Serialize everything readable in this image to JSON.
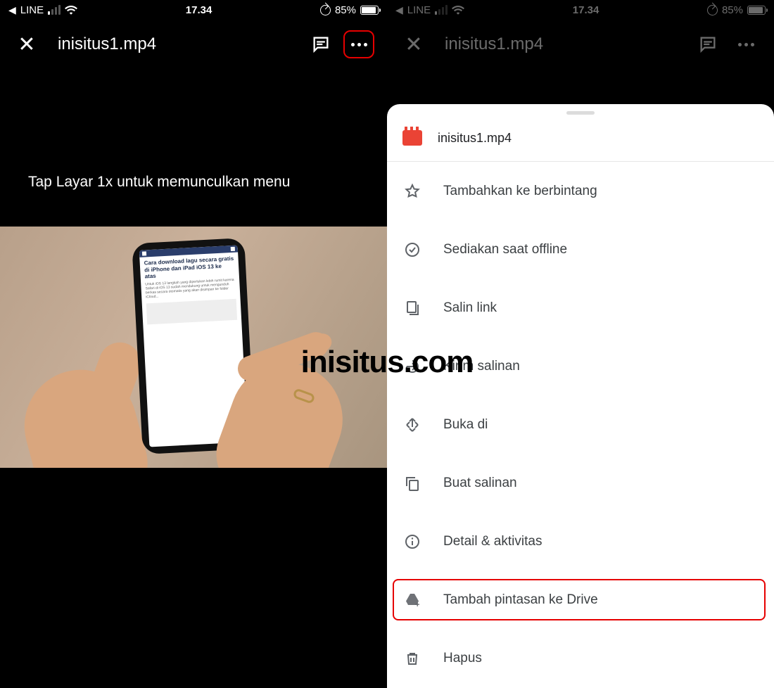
{
  "status": {
    "back_app": "LINE",
    "time": "17.34",
    "battery_pct": "85%"
  },
  "header": {
    "title": "inisitus1.mp4"
  },
  "left": {
    "instruction": "Tap Layar 1x untuk memunculkan menu",
    "article_heading": "Cara download lagu secara gratis di iPhone dan iPad iOS 13 ke atas"
  },
  "watermark": "inisitus.com",
  "sheet": {
    "filename": "inisitus1.mp4",
    "items": [
      {
        "icon": "star",
        "label": "Tambahkan ke berbintang"
      },
      {
        "icon": "offline",
        "label": "Sediakan saat offline"
      },
      {
        "icon": "link",
        "label": "Salin link"
      },
      {
        "icon": "send",
        "label": "Kirim salinan"
      },
      {
        "icon": "openin",
        "label": "Buka di"
      },
      {
        "icon": "copy",
        "label": "Buat salinan"
      },
      {
        "icon": "info",
        "label": "Detail & aktivitas"
      },
      {
        "icon": "drive",
        "label": "Tambah pintasan ke Drive",
        "highlight": true
      },
      {
        "icon": "trash",
        "label": "Hapus"
      }
    ]
  },
  "colors": {
    "highlight": "#e60000",
    "accent_red": "#ea4335",
    "icon_gray": "#5f6368"
  }
}
